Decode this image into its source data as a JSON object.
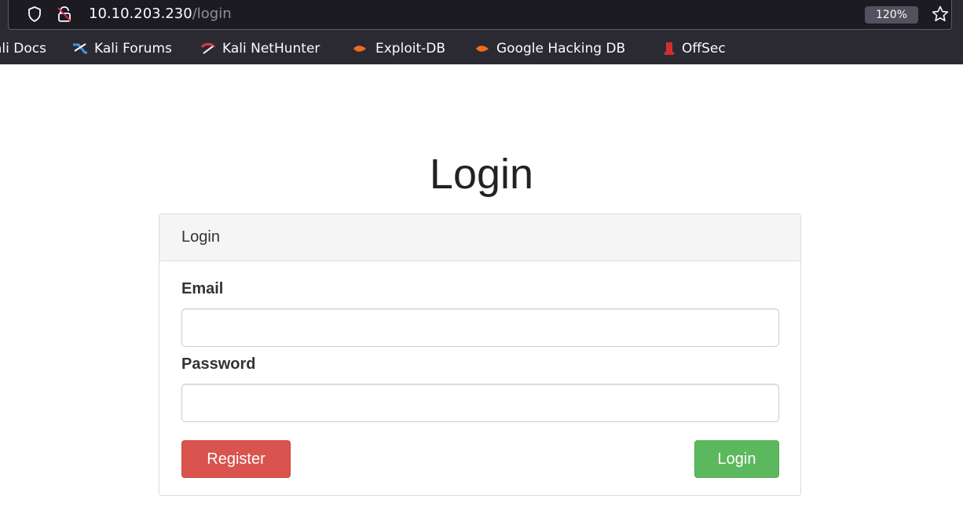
{
  "browser": {
    "url_host": "10.10.203.230",
    "url_path": "/login",
    "zoom": "120%",
    "icons": {
      "shield": "shield-icon",
      "lock": "insecure-lock-icon",
      "star": "bookmark-star-icon"
    },
    "bookmarks": [
      {
        "label": "ali Docs",
        "icon": "none"
      },
      {
        "label": "Kali Forums",
        "icon": "kali-forums-icon"
      },
      {
        "label": "Kali NetHunter",
        "icon": "kali-nethunter-icon"
      },
      {
        "label": "Exploit-DB",
        "icon": "exploit-db-icon"
      },
      {
        "label": "Google Hacking DB",
        "icon": "ghdb-icon"
      },
      {
        "label": "OffSec",
        "icon": "offsec-icon"
      }
    ]
  },
  "page": {
    "title": "Login",
    "panel": {
      "heading": "Login",
      "email_label": "Email",
      "email_value": "",
      "password_label": "Password",
      "password_value": "",
      "register_button": "Register",
      "login_button": "Login"
    }
  },
  "colors": {
    "register": "#d9534f",
    "login": "#5cb85c",
    "chrome": "#2b2a33"
  }
}
